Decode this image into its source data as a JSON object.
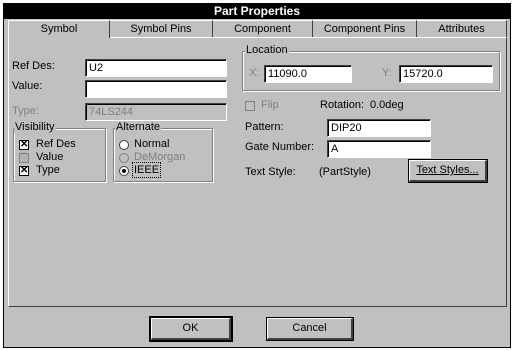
{
  "window": {
    "title": "Part Properties"
  },
  "tabs": [
    {
      "label": "Symbol",
      "active": true
    },
    {
      "label": "Symbol Pins",
      "active": false
    },
    {
      "label": "Component",
      "active": false
    },
    {
      "label": "Component Pins",
      "active": false
    },
    {
      "label": "Attributes",
      "active": false
    }
  ],
  "symbol": {
    "refdes_label": "Ref Des:",
    "refdes_value": "U2",
    "value_label": "Value:",
    "value_value": "",
    "type_label": "Type:",
    "type_value": "74LS244"
  },
  "visibility": {
    "title": "Visibility",
    "items": [
      {
        "label": "Ref Des",
        "checked": true
      },
      {
        "label": "Value",
        "checked": true,
        "grayed": true
      },
      {
        "label": "Type",
        "checked": true
      }
    ]
  },
  "alternate": {
    "title": "Alternate",
    "options": [
      {
        "label": "Normal",
        "selected": false,
        "enabled": true
      },
      {
        "label": "DeMorgan",
        "selected": false,
        "enabled": false
      },
      {
        "label": "IEEE",
        "selected": true,
        "enabled": true
      }
    ]
  },
  "location": {
    "title": "Location",
    "x_label": "X:",
    "x_value": "11090.0",
    "y_label": "Y:",
    "y_value": "15720.0"
  },
  "flip_label": "Flip",
  "rotation_label": "Rotation:",
  "rotation_value": "0.0deg",
  "pattern_label": "Pattern:",
  "pattern_value": "DIP20",
  "gate_label": "Gate Number:",
  "gate_value": "A",
  "text_style_label": "Text Style:",
  "text_style_value": "(PartStyle)",
  "buttons": {
    "text_styles": "Text Styles...",
    "ok": "OK",
    "cancel": "Cancel"
  }
}
